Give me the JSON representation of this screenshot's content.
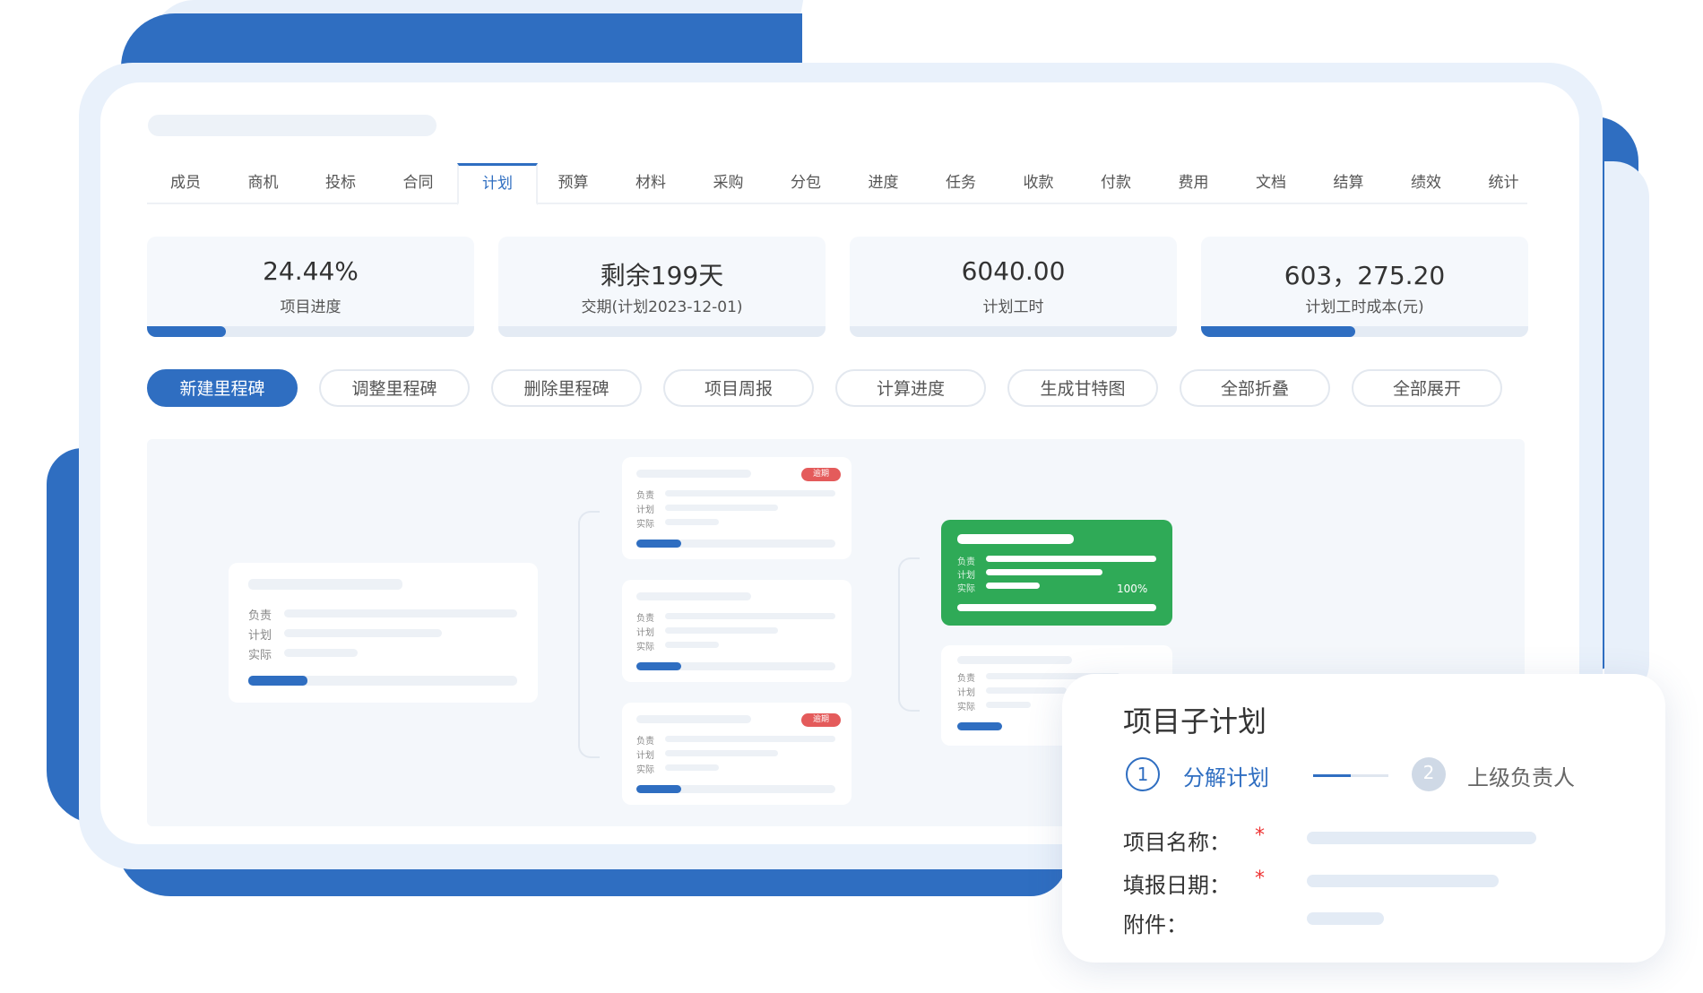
{
  "tabs": [
    "成员",
    "商机",
    "投标",
    "合同",
    "计划",
    "预算",
    "材料",
    "采购",
    "分包",
    "进度",
    "任务",
    "收款",
    "付款",
    "费用",
    "文档",
    "结算",
    "绩效",
    "统计"
  ],
  "active_tab": "计划",
  "stats": [
    {
      "value": "24.44%",
      "label": "项目进度",
      "progress": 0.24
    },
    {
      "value": "剩余199天",
      "label": "交期(计划2023-12-01)",
      "progress": null
    },
    {
      "value": "6040.00",
      "label": "计划工时",
      "progress": null
    },
    {
      "value": "603，275.20",
      "label": "计划工时成本(元)",
      "progress": 0.47
    }
  ],
  "actions": [
    "新建里程碑",
    "调整里程碑",
    "删除里程碑",
    "项目周报",
    "计算进度",
    "生成甘特图",
    "全部折叠",
    "全部展开"
  ],
  "tree": {
    "root_labels": [
      "负责",
      "计划",
      "实际"
    ],
    "child_labels": [
      "负责",
      "计划",
      "实际"
    ],
    "tag": "逾期",
    "green_percent": "100%"
  },
  "dialog": {
    "title": "项目子计划",
    "steps": [
      {
        "num": "1",
        "label": "分解计划",
        "active": true
      },
      {
        "num": "2",
        "label": "上级负责人",
        "active": false
      }
    ],
    "fields": [
      {
        "label": "项目名称：",
        "required": true
      },
      {
        "label": "填报日期：",
        "required": true
      },
      {
        "label": "附件：",
        "required": false
      }
    ],
    "required_mark": "*"
  },
  "colors": {
    "accent": "#2f6ec1",
    "success": "#2faa57",
    "danger": "#e45b5b"
  }
}
